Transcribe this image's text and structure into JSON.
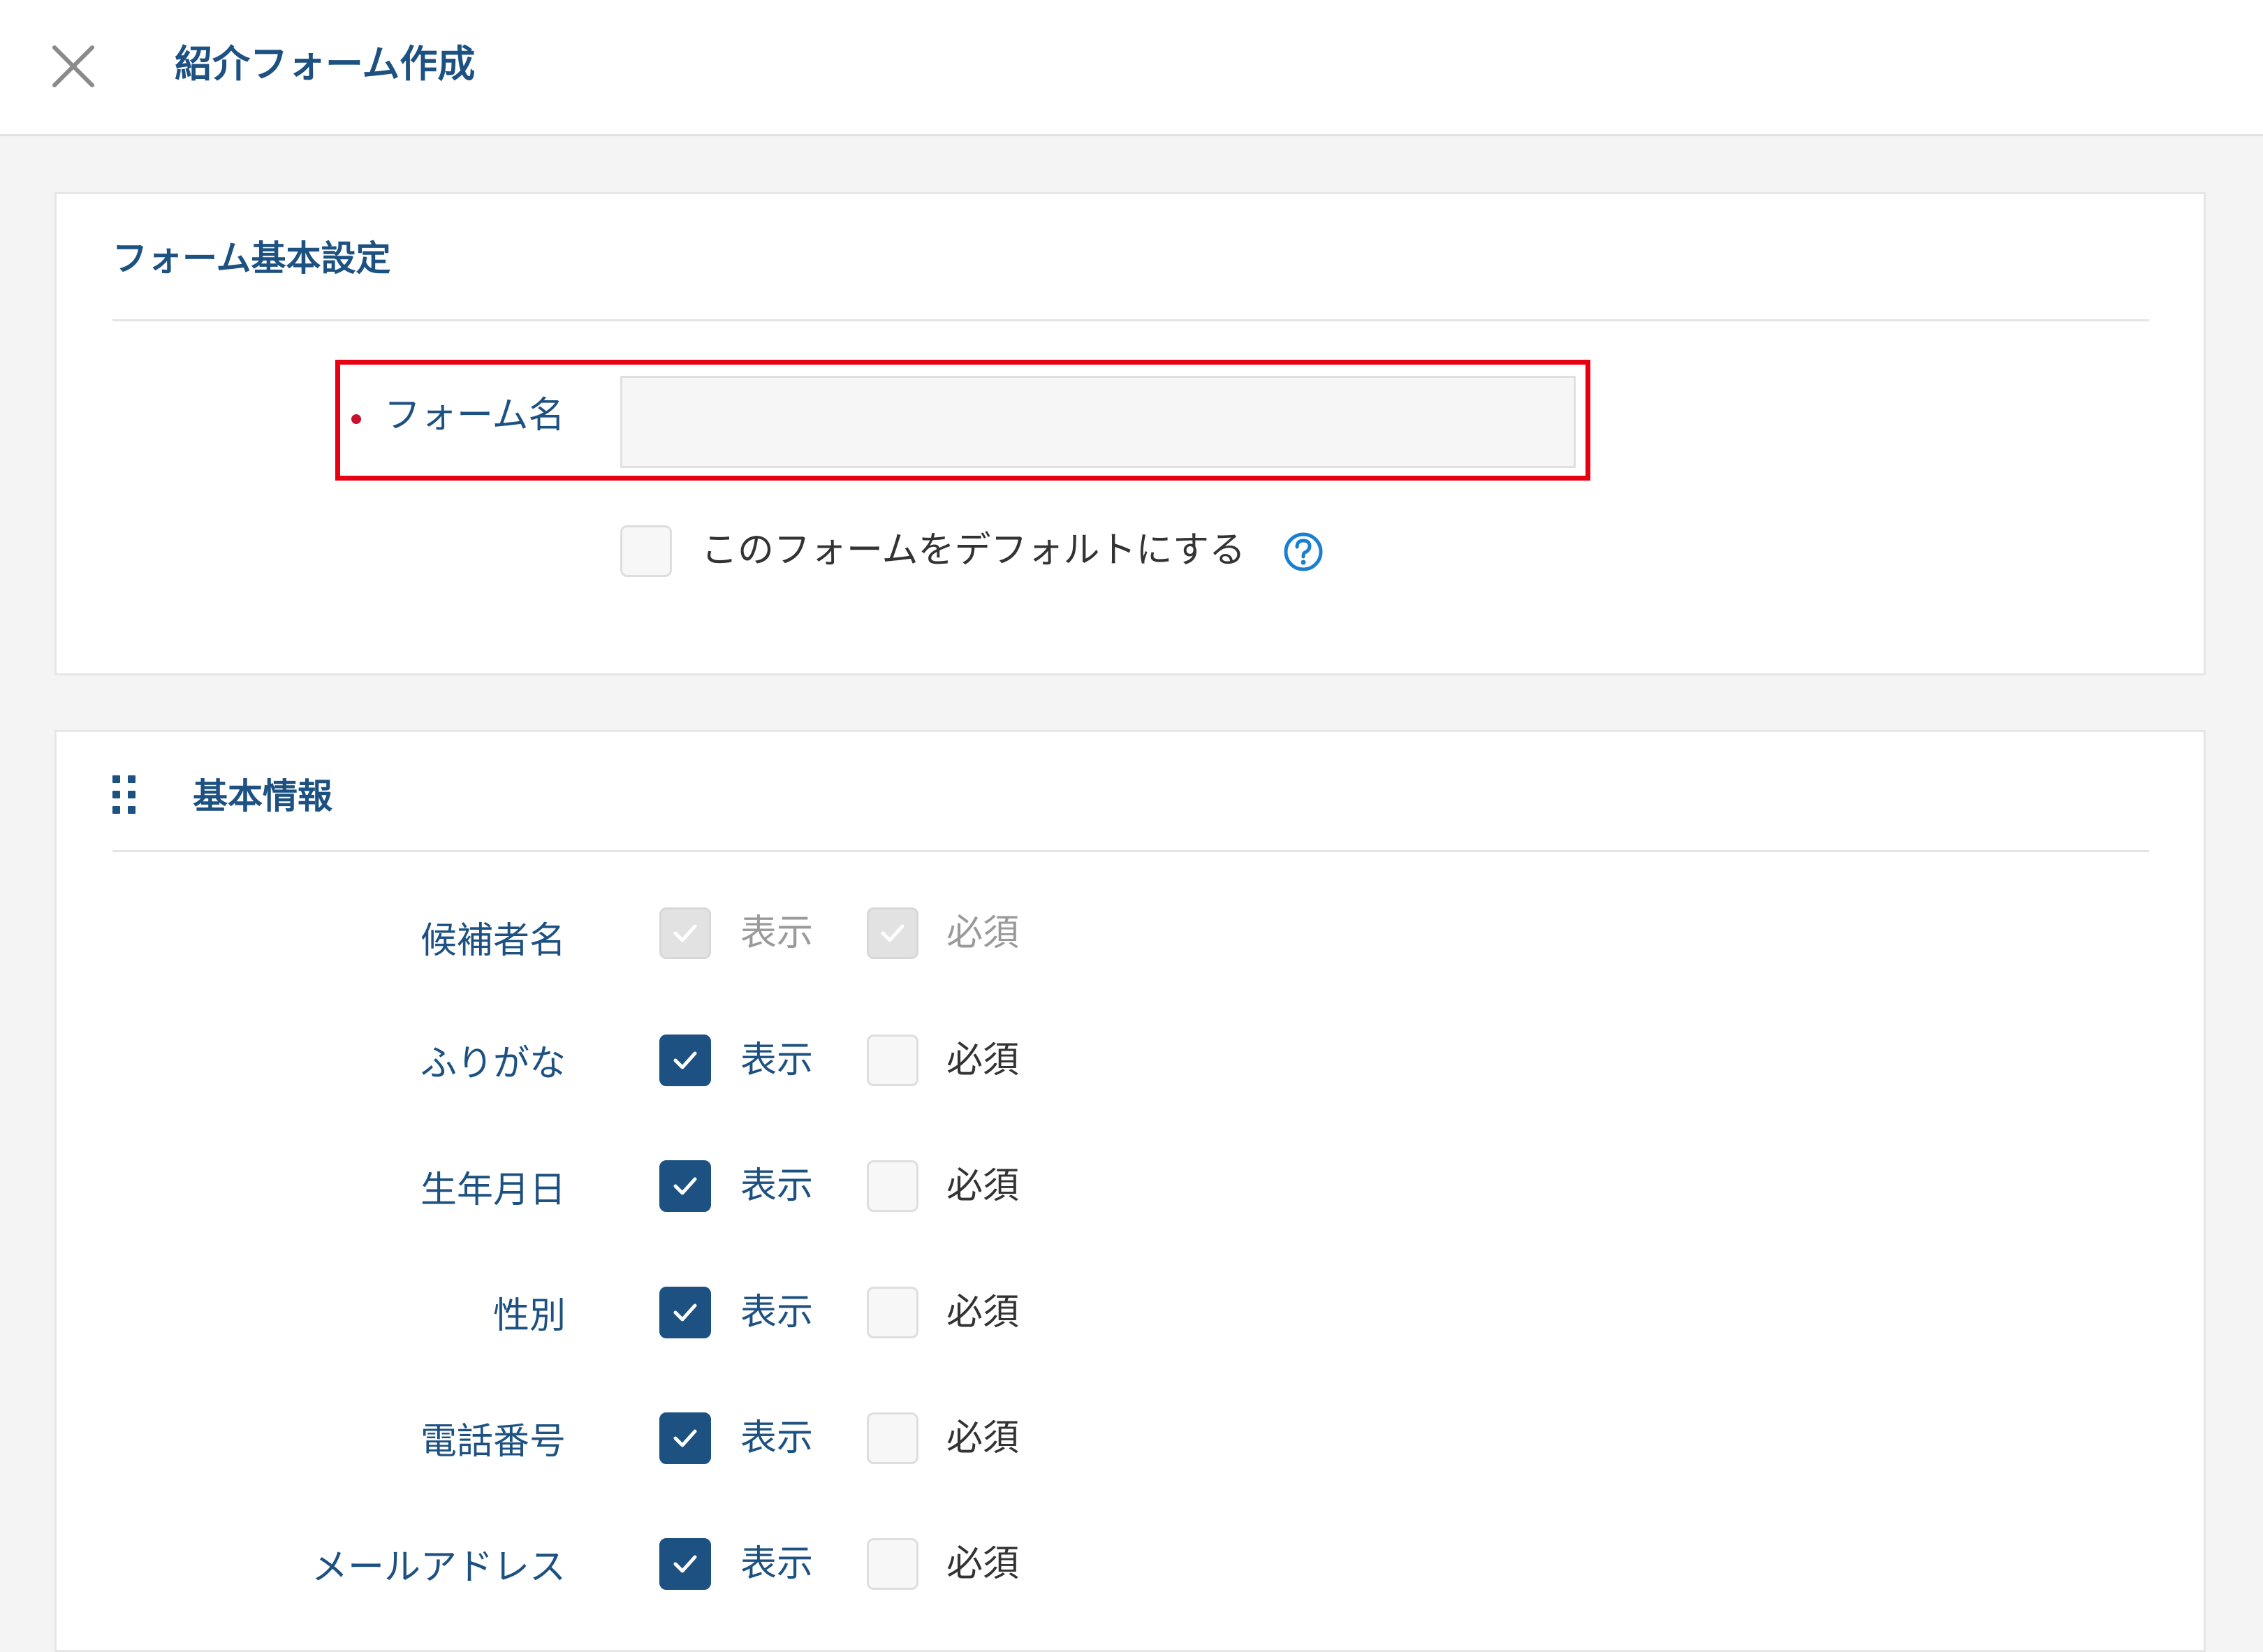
{
  "header": {
    "title": "紹介フォーム作成",
    "close_icon": "close-icon"
  },
  "form_settings": {
    "section_title": "フォーム基本設定",
    "form_name_label": "フォーム名",
    "form_name_value": "",
    "form_name_required": true,
    "default_checkbox_label": "このフォームをデフォルトにする",
    "default_checked": false,
    "help_icon": "question-circle-icon"
  },
  "basic_info": {
    "section_title": "基本情報",
    "drag_icon": "drag-handle-icon",
    "show_label": "表示",
    "required_label": "必須",
    "rows": [
      {
        "label": "候補者名",
        "show": true,
        "required": true,
        "disabled": true
      },
      {
        "label": "ふりがな",
        "show": true,
        "required": false,
        "disabled": false
      },
      {
        "label": "生年月日",
        "show": true,
        "required": false,
        "disabled": false
      },
      {
        "label": "性別",
        "show": true,
        "required": false,
        "disabled": false
      },
      {
        "label": "電話番号",
        "show": true,
        "required": false,
        "disabled": false
      },
      {
        "label": "メールアドレス",
        "show": true,
        "required": false,
        "disabled": false
      }
    ]
  },
  "colors": {
    "brand": "#1d5181",
    "highlight": "#e60012",
    "required_dot": "#c8102e"
  }
}
